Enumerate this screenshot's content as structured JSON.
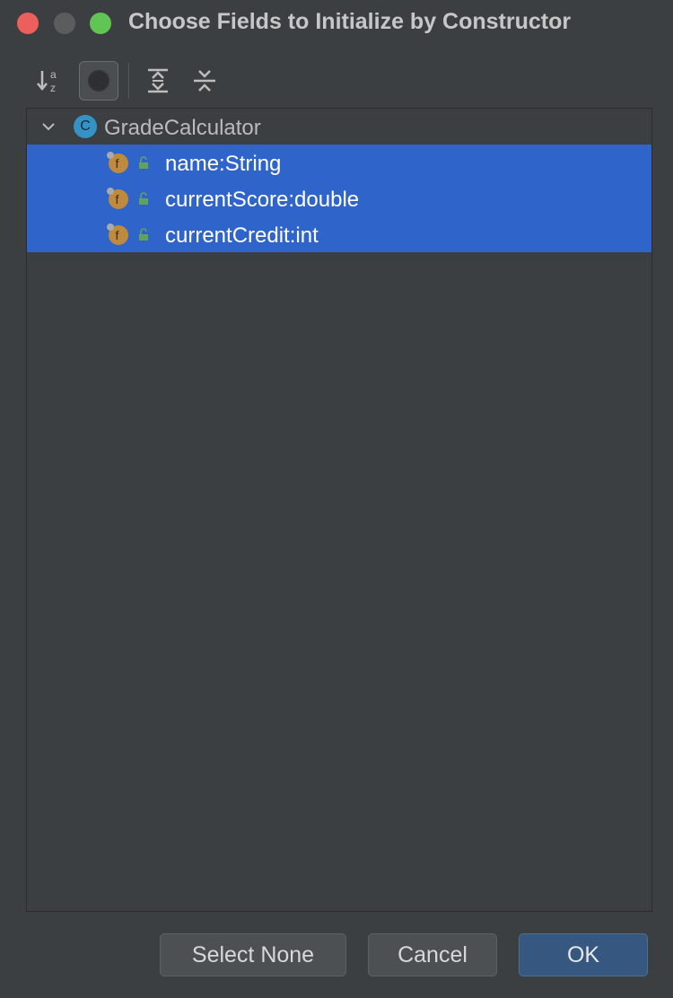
{
  "window": {
    "title": "Choose Fields to Initialize by Constructor"
  },
  "toolbar": {
    "items": [
      {
        "icon": "sort-alphabetically-icon"
      },
      {
        "icon": "show-classes-icon"
      },
      {
        "icon": "expand-all-icon"
      },
      {
        "icon": "collapse-all-icon"
      }
    ]
  },
  "tree": {
    "root": {
      "label": "GradeCalculator",
      "icon_letter": "C",
      "expanded": true
    },
    "fields": [
      {
        "label": "name:String",
        "selected": true
      },
      {
        "label": "currentScore:double",
        "selected": true
      },
      {
        "label": "currentCredit:int",
        "selected": true
      }
    ]
  },
  "buttons": {
    "select_none": "Select None",
    "cancel": "Cancel",
    "ok": "OK"
  },
  "colors": {
    "selection": "#2f65ca",
    "class_icon": "#3592c4",
    "field_icon": "#c08a3e",
    "lock_icon": "#5fa35f",
    "primary_button": "#365880"
  }
}
